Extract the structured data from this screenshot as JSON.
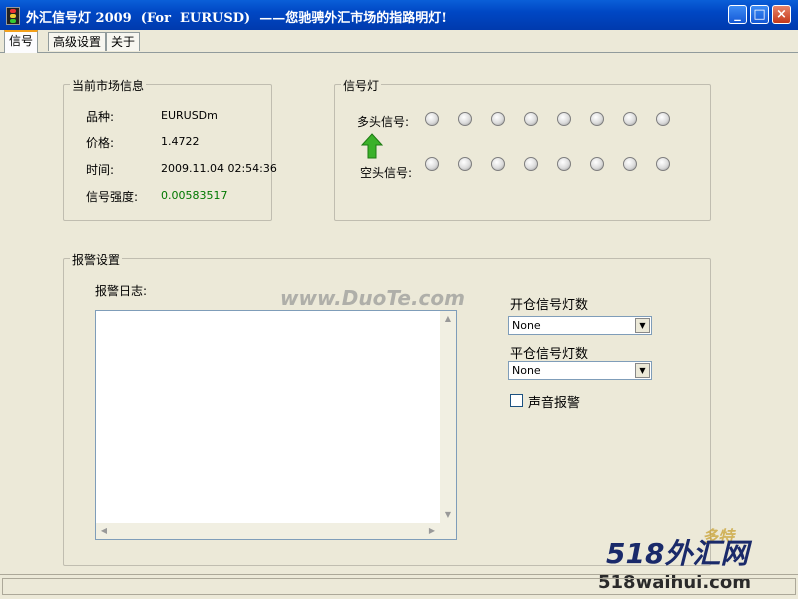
{
  "window": {
    "title": "外汇信号灯 2009  (For  EURUSD)  ——您驰骋外汇市场的指路明灯!",
    "minimize_glyph": "_",
    "maximize_glyph": "□",
    "close_glyph": "×"
  },
  "tabs": [
    {
      "label": "信号",
      "active": true
    },
    {
      "label": "高级设置",
      "active": false
    },
    {
      "label": "关于",
      "active": false
    }
  ],
  "market": {
    "legend": "当前市场信息",
    "symbol_label": "品种:",
    "symbol_value": "EURUSDm",
    "price_label": "价格:",
    "price_value": "1.4722",
    "time_label": "时间:",
    "time_value": "2009.11.04 02:54:36",
    "strength_label": "信号强度:",
    "strength_value": "0.00583517",
    "strength_color": "#007800"
  },
  "signal": {
    "legend": "信号灯",
    "long_label": "多头信号:",
    "short_label": "空头信号:",
    "long_lights": 8,
    "short_lights": 8,
    "arrow_direction": "up",
    "arrow_color": "#3bb12a"
  },
  "alarm": {
    "legend": "报警设置",
    "log_label": "报警日志:",
    "open_label": "开仓信号灯数",
    "open_value": "None",
    "close_label": "平仓信号灯数",
    "close_value": "None",
    "sound_label": "声音报警",
    "sound_checked": false
  },
  "watermarks": {
    "duote": "www.DuoTe.com",
    "duote_cn": "多特",
    "site_brand": "518外汇网",
    "site_url": "518waihui.com"
  }
}
